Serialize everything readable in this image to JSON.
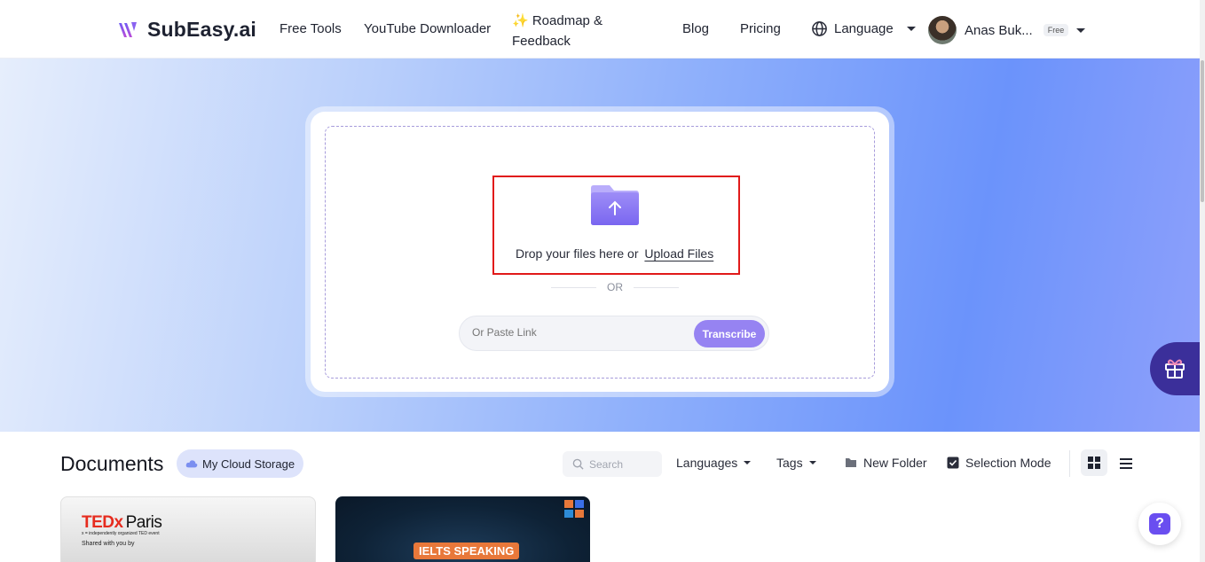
{
  "header": {
    "logo_text": "SubEasy.ai",
    "nav": {
      "free_tools": "Free Tools",
      "youtube_downloader": "YouTube Downloader",
      "roadmap_line1": "✨ Roadmap &",
      "roadmap_line2": "Feedback",
      "blog": "Blog",
      "pricing": "Pricing"
    },
    "language_label": "Language",
    "user": {
      "name": "Anas Buk...",
      "plan_badge": "Free"
    }
  },
  "upload": {
    "drop_text": "Drop your files here or",
    "upload_link": "Upload Files",
    "or_label": "OR",
    "paste_placeholder": "Or Paste Link",
    "transcribe_label": "Transcribe"
  },
  "documents": {
    "title": "Documents",
    "storage_label": "My Cloud Storage",
    "search_placeholder": "Search",
    "languages_label": "Languages",
    "tags_label": "Tags",
    "new_folder_label": "New Folder",
    "selection_mode_label": "Selection Mode",
    "cards": [
      {
        "brand": "TEDx",
        "city": "Paris",
        "subtitle": "x = independently organized TED event",
        "shared": "Shared with you by"
      },
      {
        "tag": "IELTS SPEAKING"
      }
    ]
  },
  "colors": {
    "accent": "#9683f2",
    "hero_from": "#e6eefc",
    "hero_to": "#6b93fb",
    "highlight": "#e11a1a"
  }
}
